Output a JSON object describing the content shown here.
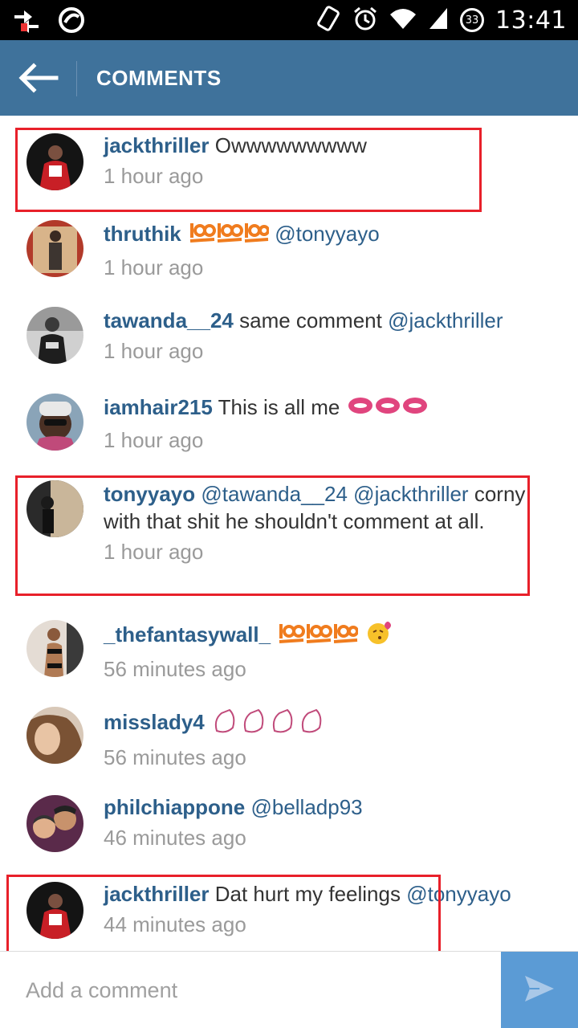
{
  "status_bar": {
    "time": "13:41",
    "battery": "33",
    "icons": [
      "data-transfer-icon",
      "app-notification-icon",
      "rotate-icon",
      "alarm-icon",
      "wifi-icon",
      "signal-icon",
      "battery-icon"
    ]
  },
  "action_bar": {
    "title": "COMMENTS",
    "back_icon": "back-arrow-icon"
  },
  "comments": [
    {
      "username": "jackthriller",
      "text": "Owwwwwwwww",
      "mentions": [],
      "emoji": "",
      "time": "1 hour ago",
      "highlighted": true
    },
    {
      "username": "thruthik",
      "text": "",
      "mentions": [
        "@tonyyayo"
      ],
      "emoji": "hundred-points-x3",
      "time": "1 hour ago",
      "highlighted": false
    },
    {
      "username": "tawanda__24",
      "text": "same comment",
      "mentions": [
        "@jackthriller"
      ],
      "emoji": "",
      "time": "1 hour ago",
      "highlighted": false
    },
    {
      "username": "iamhair215",
      "text": "This is all me",
      "mentions": [],
      "emoji": "kiss-lips-x3",
      "time": "1 hour ago",
      "highlighted": false
    },
    {
      "username": "tonyyayo",
      "text": "corny with that shit he shouldn't comment at all.",
      "mentions": [
        "@tawanda__24",
        "@jackthriller"
      ],
      "emoji": "",
      "time": "1 hour ago",
      "highlighted": true
    },
    {
      "username": "_thefantasywall_",
      "text": "",
      "mentions": [],
      "emoji": "hundred-points-x3-kissing-face",
      "time": "56 minutes ago",
      "highlighted": false
    },
    {
      "username": "misslady4",
      "text": "",
      "mentions": [],
      "emoji": "clapping-hands-x4",
      "time": "56 minutes ago",
      "highlighted": false
    },
    {
      "username": "philchiappone",
      "text": "",
      "mentions": [
        "@belladp93"
      ],
      "emoji": "",
      "time": "46 minutes ago",
      "highlighted": false
    },
    {
      "username": "jackthriller",
      "text": "Dat hurt my feelings",
      "mentions": [
        "@tonyyayo"
      ],
      "emoji": "",
      "time": "44 minutes ago",
      "highlighted": true
    }
  ],
  "composer": {
    "placeholder": "Add a comment",
    "send_icon": "send-icon"
  },
  "colors": {
    "action_bar": "#3f729b",
    "username": "#2d5f8a",
    "highlight": "#e8202a",
    "send_button": "#5b9bd5"
  }
}
